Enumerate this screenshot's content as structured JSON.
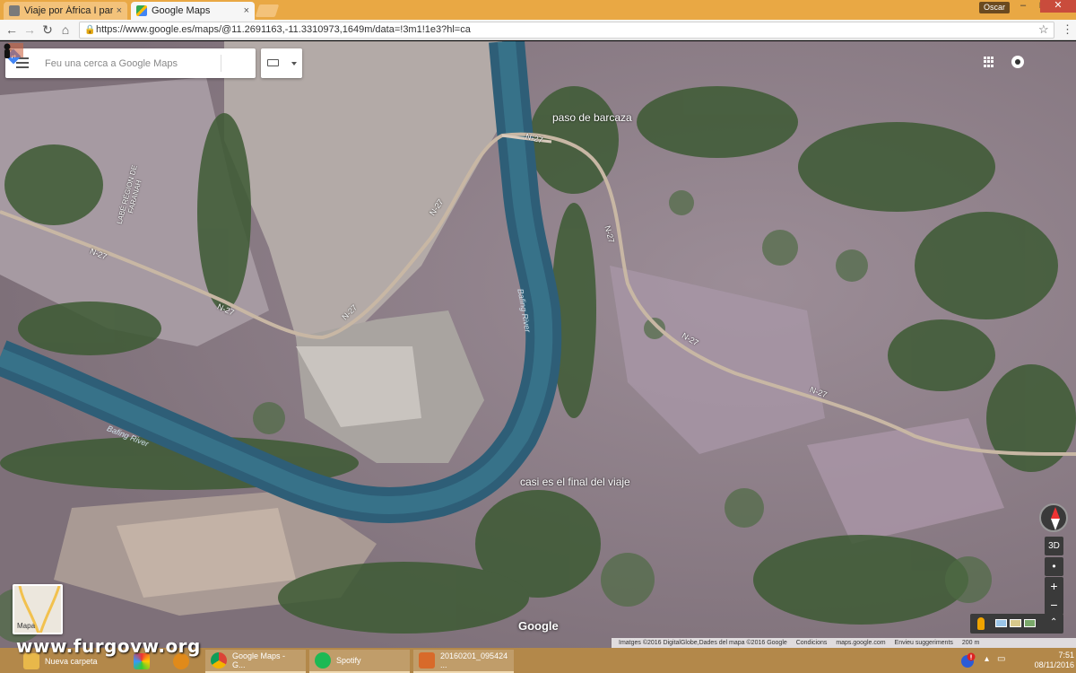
{
  "browser": {
    "tabs": [
      {
        "title": "Viaje por África I parte y",
        "favicon": "photo-icon",
        "active": false
      },
      {
        "title": "Google Maps",
        "favicon": "maps-icon",
        "active": true
      }
    ],
    "close_glyph": "×",
    "profile_name": "Oscar",
    "window_controls": {
      "minimize": "–",
      "maximize": "□",
      "close": "✕"
    },
    "url": "https://www.google.es/maps/@11.2691163,-11.3310973,1649m/data=!3m1!1e3?hl=ca",
    "nav": {
      "back": "←",
      "forward": "→",
      "reload": "↻",
      "home": "⌂",
      "lock": "🔒",
      "bookmark": "☆",
      "menu": "⋮"
    }
  },
  "maps": {
    "search_placeholder": "Feu una cerca a Google Maps",
    "annotations": {
      "ferry": "paso de barcaza",
      "end": "casi es el final del viaje"
    },
    "road_labels": [
      "N-27",
      "N-27",
      "N-27",
      "N-27",
      "N-27",
      "N-27",
      "N-27",
      "N-27"
    ],
    "river_labels": [
      "Bafing River",
      "Bafing River"
    ],
    "region_label": "LABÉ RÉGION DE FARANAH",
    "minimap_label": "Mapa",
    "google_logo": "Google",
    "controls": {
      "three_d": "3D",
      "zoom_in": "+",
      "zoom_out": "−",
      "expand": "⌃"
    },
    "footer": {
      "imagery": "Imatges ©2016 DigitalGlobe,Dades del mapa ©2016 Google",
      "terms": "Condicions",
      "site": "maps.google.com",
      "feedback": "Envieu suggeriments",
      "scale": "200 m"
    }
  },
  "taskbar": {
    "watermark": "www.furgovw.org",
    "items": [
      {
        "label": "Nueva carpeta",
        "icon": "folder-icon",
        "color": "#e8b84a"
      },
      {
        "label": "",
        "icon": "photos-icon",
        "color": "#cc3a2a"
      },
      {
        "label": "",
        "icon": "media-icon",
        "color": "#e08a1a"
      },
      {
        "label": "Google Maps - G...",
        "icon": "chrome-icon",
        "color": "#2a8a3a"
      },
      {
        "label": "Spotify",
        "icon": "spotify-icon",
        "color": "#1db954"
      },
      {
        "label": "20160201_095424 ...",
        "icon": "image-icon",
        "color": "#d86a2a"
      }
    ],
    "clock_time": "7:51",
    "clock_date": "08/11/2016"
  }
}
